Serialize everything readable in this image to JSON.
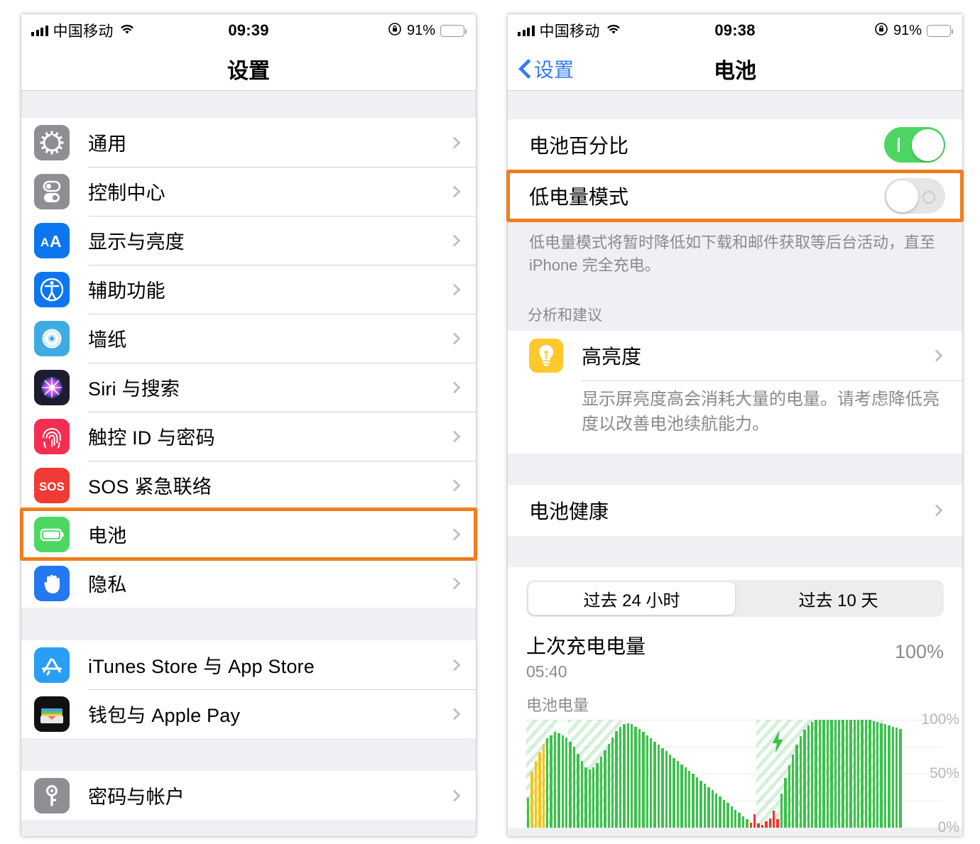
{
  "left_phone": {
    "status_bar": {
      "carrier": "中国移动",
      "time": "09:39",
      "battery_percent": "91%",
      "battery_color": "#fdc72e",
      "icons": [
        "signal-bars-icon",
        "wifi-icon",
        "rotation-lock-icon",
        "battery-icon"
      ]
    },
    "nav": {
      "title": "设置"
    },
    "groups": [
      {
        "items": [
          {
            "label": "通用",
            "icon": "gear-icon",
            "icon_bg": "#8e8e93"
          },
          {
            "label": "控制中心",
            "icon": "sliders-icon",
            "icon_bg": "#8e8e93"
          },
          {
            "label": "显示与亮度",
            "icon": "aa-text-icon",
            "icon_bg": "#0b76ef"
          },
          {
            "label": "辅助功能",
            "icon": "accessibility-icon",
            "icon_bg": "#0b76ef"
          },
          {
            "label": "墙纸",
            "icon": "wallpaper-icon",
            "icon_bg": "#3eabe3"
          },
          {
            "label": "Siri 与搜索",
            "icon": "siri-icon",
            "icon_bg": "#1c1c2e"
          },
          {
            "label": "触控 ID 与密码",
            "icon": "fingerprint-icon",
            "icon_bg": "#f42e52"
          },
          {
            "label": "SOS 紧急联络",
            "icon": "sos-icon",
            "icon_bg": "#ef3b33"
          },
          {
            "label": "电池",
            "icon": "battery-icon",
            "icon_bg": "#4cd763",
            "highlighted": true
          },
          {
            "label": "隐私",
            "icon": "hand-privacy-icon",
            "icon_bg": "#2478f0"
          }
        ]
      },
      {
        "items": [
          {
            "label": "iTunes Store 与 App Store",
            "icon": "app-store-icon",
            "icon_bg": "#2a9ef4"
          },
          {
            "label": "钱包与 Apple Pay",
            "icon": "wallet-icon",
            "icon_bg": "#111111"
          }
        ]
      },
      {
        "items": [
          {
            "label": "密码与帐户",
            "icon": "key-icon",
            "icon_bg": "#8e8e93"
          }
        ]
      }
    ]
  },
  "right_phone": {
    "status_bar": {
      "carrier": "中国移动",
      "time": "09:38",
      "battery_percent": "91%",
      "battery_color": "#000000",
      "icons": [
        "signal-bars-icon",
        "wifi-icon",
        "rotation-lock-icon",
        "battery-icon"
      ]
    },
    "nav": {
      "back_label": "设置",
      "title": "电池"
    },
    "toggles": [
      {
        "label": "电池百分比",
        "state": "on",
        "state_text": "开"
      },
      {
        "label": "低电量模式",
        "state": "off",
        "state_text": "关",
        "highlighted": true
      }
    ],
    "low_power_note": "低电量模式将暂时降低如下载和邮件获取等后台活动，直至 iPhone 完全充电。",
    "suggestions": {
      "header": "分析和建议",
      "title": "高亮度",
      "icon": "lightbulb-icon",
      "icon_bg": "#ffc82c",
      "description": "显示屏亮度高会消耗大量的电量。请考虑降低亮度以改善电池续航能力。"
    },
    "battery_health_row": {
      "label": "电池健康"
    },
    "segmented": {
      "options": [
        "过去 24 小时",
        "过去 10 天"
      ],
      "selected_index": 0
    },
    "last_charge": {
      "title": "上次充电电量",
      "time": "05:40",
      "value": "100%"
    },
    "chart_caption": "电池电量"
  },
  "chart_data": {
    "type": "bar",
    "title": "电池电量",
    "xlabel": "",
    "ylabel": "",
    "ylim": [
      0,
      100
    ],
    "ytick_labels": [
      "100%",
      "50%",
      "0%"
    ],
    "ytick_values": [
      100,
      50,
      0
    ],
    "gridlines": [
      100,
      75,
      50,
      25,
      0
    ],
    "grid": true,
    "legend": "none",
    "bar_colors": {
      "green": "#3cc14b",
      "yellow": "#f5c518",
      "red": "#f3322c"
    },
    "values": [
      28,
      52,
      62,
      70,
      78,
      83,
      86,
      89,
      88,
      86,
      84,
      80,
      75,
      69,
      62,
      56,
      54,
      56,
      60,
      66,
      72,
      78,
      84,
      90,
      94,
      96,
      97,
      96,
      94,
      92,
      89,
      86,
      83,
      80,
      77,
      74,
      71,
      68,
      65,
      62,
      59,
      56,
      53,
      50,
      47,
      44,
      41,
      38,
      35,
      32,
      29,
      26,
      23,
      20,
      17,
      14,
      11,
      8,
      5,
      13,
      4,
      3,
      6,
      9,
      16,
      8,
      32,
      46,
      58,
      68,
      77,
      85,
      91,
      95,
      98,
      100,
      100,
      100,
      100,
      100,
      100,
      100,
      100,
      100,
      100,
      100,
      100,
      100,
      100,
      100,
      99,
      98,
      97,
      96,
      95,
      94,
      93,
      92
    ],
    "colors": [
      "green",
      "yellow",
      "yellow",
      "yellow",
      "yellow",
      "green",
      "green",
      "green",
      "green",
      "green",
      "green",
      "green",
      "green",
      "green",
      "green",
      "green",
      "green",
      "green",
      "green",
      "green",
      "green",
      "green",
      "green",
      "green",
      "green",
      "green",
      "green",
      "green",
      "green",
      "green",
      "green",
      "green",
      "green",
      "green",
      "green",
      "green",
      "green",
      "green",
      "green",
      "green",
      "green",
      "green",
      "green",
      "green",
      "green",
      "green",
      "green",
      "green",
      "green",
      "green",
      "green",
      "green",
      "green",
      "green",
      "green",
      "green",
      "green",
      "green",
      "red",
      "red",
      "red",
      "red",
      "red",
      "red",
      "red",
      "red",
      "green",
      "green",
      "green",
      "green",
      "green",
      "green",
      "green",
      "green",
      "green",
      "green",
      "green",
      "green",
      "green",
      "green",
      "green",
      "green",
      "green",
      "green",
      "green",
      "green",
      "green",
      "green",
      "green",
      "green",
      "green",
      "green",
      "green",
      "green",
      "green",
      "green",
      "green",
      "green"
    ],
    "usage_bands": [
      {
        "start_index": 0,
        "end_index": 7,
        "label": "screen-on-band"
      },
      {
        "start_index": 11,
        "end_index": 24,
        "label": "screen-on-band"
      },
      {
        "start_index": 60,
        "end_index": 76,
        "label": "charging-band"
      },
      {
        "start_index": 78,
        "end_index": 92,
        "label": "screen-on-band"
      }
    ],
    "charge_marker": {
      "index": 63,
      "icon": "lightning-bolt-icon"
    }
  },
  "annotations": {
    "highlight_color": "#f07d1e",
    "boxes": [
      {
        "name": "battery-settings-row-highlight",
        "panel": "left"
      },
      {
        "name": "low-power-mode-row-highlight",
        "panel": "right"
      }
    ]
  }
}
